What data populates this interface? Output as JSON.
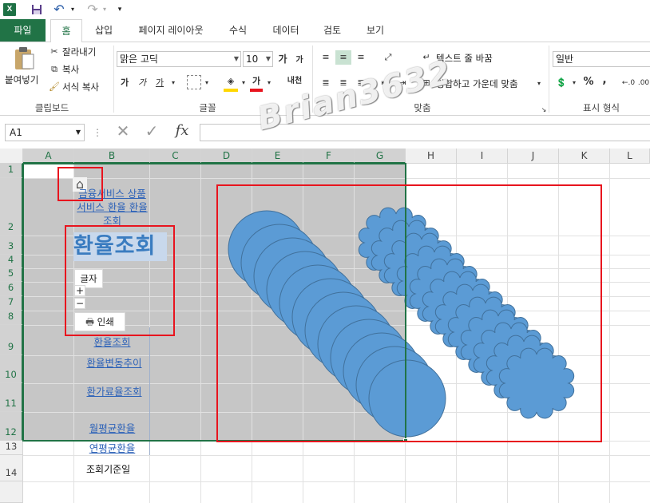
{
  "qat": {
    "app_icon": "X",
    "save_icon": "save-icon",
    "undo_icon": "undo-icon",
    "redo_icon": "redo-icon",
    "customize_icon": "customize-qat-icon"
  },
  "tabs": [
    {
      "label": "파일"
    },
    {
      "label": "홈"
    },
    {
      "label": "삽입"
    },
    {
      "label": "페이지 레이아웃"
    },
    {
      "label": "수식"
    },
    {
      "label": "데이터"
    },
    {
      "label": "검토"
    },
    {
      "label": "보기"
    }
  ],
  "ribbon": {
    "clipboard": {
      "paste": "붙여넣기",
      "cut": "잘라내기",
      "copy": "복사",
      "format_painter": "서식 복사",
      "label": "클립보드"
    },
    "font": {
      "name": "맑은 고딕",
      "size": "10",
      "grow": "가",
      "shrink": "가",
      "bold": "가",
      "italic": "가",
      "underline": "가",
      "font_color": "가",
      "phonetic": "내천",
      "label": "글꼴"
    },
    "alignment": {
      "wrap_text": "텍스트 줄 바꿈",
      "merge_center": "병합하고 가운데 맞춤",
      "label": "맞춤"
    },
    "number": {
      "format": "일반",
      "percent": "%",
      "comma": ",",
      "label": "표시 형식"
    }
  },
  "formula_bar": {
    "name_box": "A1",
    "cancel": "✕",
    "enter": "✓",
    "fx": "fx",
    "value": ""
  },
  "columns": [
    "A",
    "B",
    "C",
    "D",
    "E",
    "F",
    "G",
    "H",
    "I",
    "J",
    "K",
    "L"
  ],
  "rows": [
    "1",
    "2",
    "3",
    "4",
    "5",
    "6",
    "7",
    "8",
    "9",
    "10",
    "11",
    "12",
    "13",
    "14"
  ],
  "sheet": {
    "breadcrumb_link": "금융서비스 상품서비스 환율 환율조회",
    "title": "환율조회",
    "zoom_button": "글자",
    "zoom_in": "+",
    "zoom_out": "−",
    "print_button": "인쇄",
    "menu": [
      "환율조회",
      "환율변동추이",
      "환가료율조회",
      "월평균환율",
      "연평균환율"
    ],
    "base_date": "조회기준일"
  },
  "watermark": "Brian3632",
  "colors": {
    "excel_green": "#217346",
    "shape_blue": "#5b9bd5",
    "shape_outline": "#41719c",
    "annotation_red": "#e8141e",
    "selection_gray": "#c6c6c6"
  }
}
